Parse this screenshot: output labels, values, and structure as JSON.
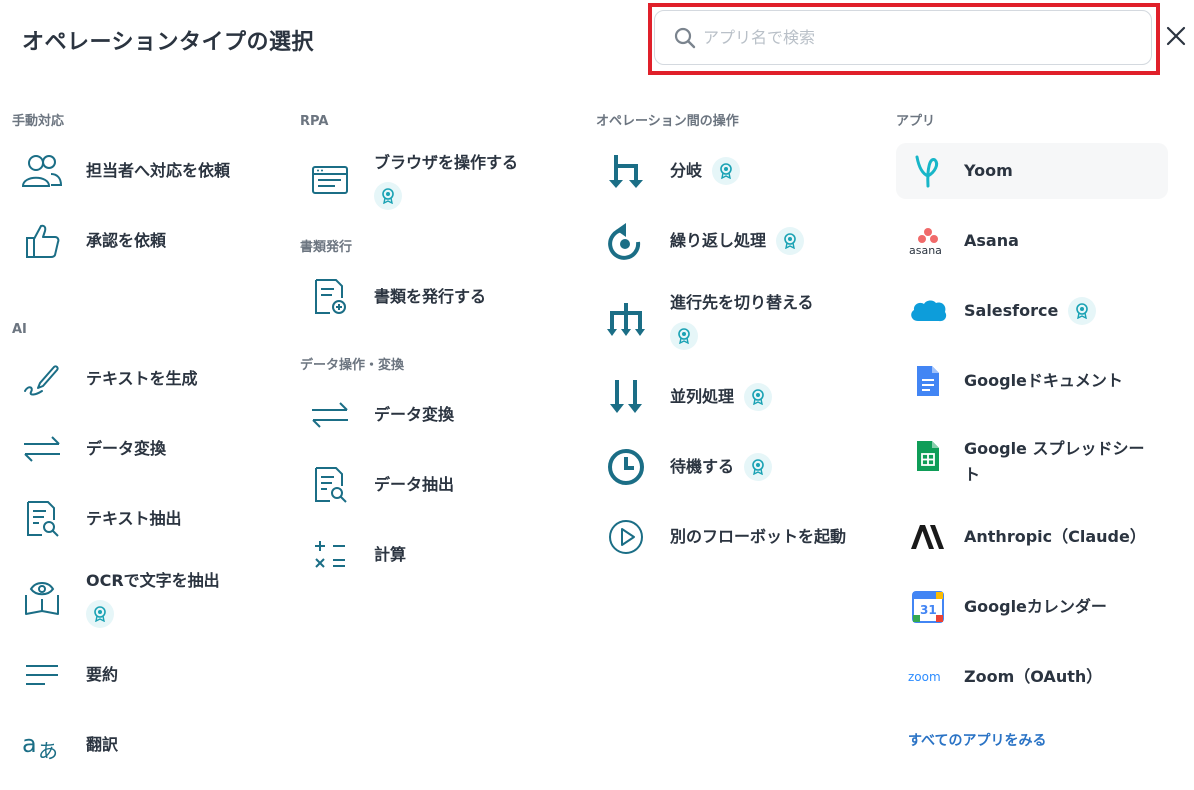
{
  "title": "オペレーションタイプの選択",
  "search": {
    "placeholder": "アプリ名で検索",
    "value": ""
  },
  "colors": {
    "accent": "#1b6e86",
    "highlight": "#e0202a",
    "link": "#2a73c5",
    "badge_bg": "#e6f6f8"
  },
  "columns": {
    "manual": {
      "title": "手動対応",
      "items": [
        {
          "label": "担当者へ対応を依頼",
          "icon": "people-icon"
        },
        {
          "label": "承認を依頼",
          "icon": "thumbs-up-icon"
        }
      ]
    },
    "ai": {
      "title": "AI",
      "items": [
        {
          "label": "テキストを生成",
          "icon": "pen-icon"
        },
        {
          "label": "データ変換",
          "icon": "arrows-icon"
        },
        {
          "label": "テキスト抽出",
          "icon": "document-search-icon"
        },
        {
          "label": "OCRで文字を抽出",
          "icon": "book-eye-icon",
          "badge": "premium-badge-icon"
        },
        {
          "label": "要約",
          "icon": "lines-icon"
        },
        {
          "label": "翻訳",
          "icon": "translate-icon"
        }
      ]
    },
    "rpa": {
      "title": "RPA",
      "items": [
        {
          "label": "ブラウザを操作する",
          "icon": "browser-icon",
          "badge": "premium-badge-icon"
        }
      ]
    },
    "docs": {
      "title": "書類発行",
      "items": [
        {
          "label": "書類を発行する",
          "icon": "document-add-icon"
        }
      ]
    },
    "data_ops": {
      "title": "データ操作・変換",
      "items": [
        {
          "label": "データ変換",
          "icon": "arrows-icon"
        },
        {
          "label": "データ抽出",
          "icon": "document-search-icon"
        },
        {
          "label": "計算",
          "icon": "calculator-icon"
        }
      ]
    },
    "ops": {
      "title": "オペレーション間の操作",
      "items": [
        {
          "label": "分岐",
          "icon": "branch-icon",
          "badge": "premium-badge-icon"
        },
        {
          "label": "繰り返し処理",
          "icon": "loop-icon",
          "badge": "premium-badge-icon"
        },
        {
          "label": "進行先を切り替える",
          "icon": "switch-icon",
          "badge": "premium-badge-icon"
        },
        {
          "label": "並列処理",
          "icon": "parallel-icon",
          "badge": "premium-badge-icon"
        },
        {
          "label": "待機する",
          "icon": "clock-icon",
          "badge": "premium-badge-icon"
        },
        {
          "label": "別のフローボットを起動",
          "icon": "play-icon"
        }
      ]
    },
    "apps": {
      "title": "アプリ",
      "items": [
        {
          "label": "Yoom",
          "icon": "yoom-logo-icon"
        },
        {
          "label": "Asana",
          "icon": "asana-logo-icon"
        },
        {
          "label": "Salesforce",
          "icon": "salesforce-logo-icon",
          "badge": "premium-badge-icon"
        },
        {
          "label": "Googleドキュメント",
          "icon": "google-docs-icon"
        },
        {
          "label": "Google スプレッドシート",
          "icon": "google-sheets-icon"
        },
        {
          "label": "Anthropic（Claude）",
          "icon": "anthropic-logo-icon"
        },
        {
          "label": "Googleカレンダー",
          "icon": "google-calendar-icon"
        },
        {
          "label": "Zoom（OAuth）",
          "icon": "zoom-logo-icon"
        }
      ],
      "see_all": "すべてのアプリをみる",
      "asana_logo_text": "asana",
      "calendar_day": "31",
      "zoom_logo_text": "zoom"
    }
  }
}
